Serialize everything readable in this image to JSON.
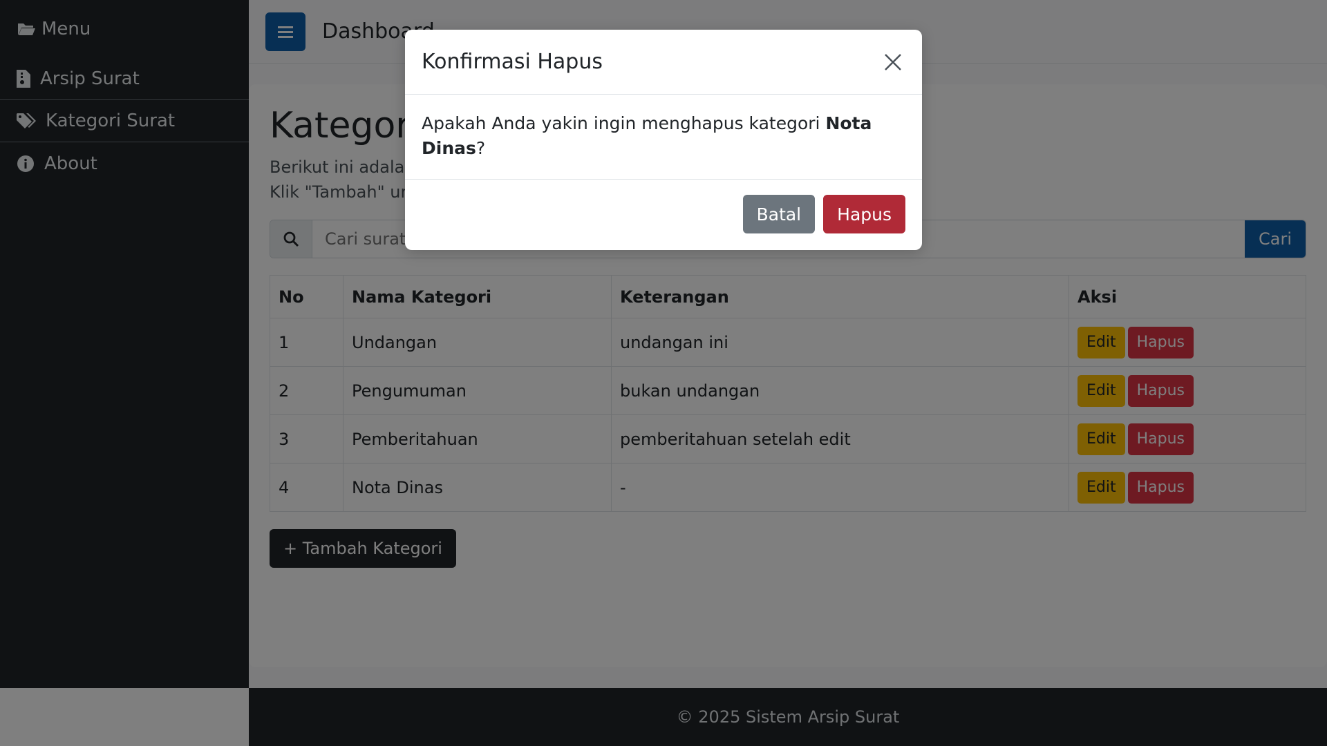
{
  "sidebar": {
    "title": "Menu",
    "items": [
      {
        "label": "Arsip Surat"
      },
      {
        "label": "Kategori Surat"
      },
      {
        "label": "About"
      }
    ]
  },
  "topbar": {
    "title": "Dashboard"
  },
  "page": {
    "title": "Kategori Surat",
    "desc_line1": "Berikut ini adalah kategori yang bisa digunakan untuk melabeli surat.",
    "desc_line2": "Klik \"Tambah\" untuk menambahkan kategori baru."
  },
  "search": {
    "placeholder": "Cari surat...",
    "button": "Cari"
  },
  "table": {
    "headers": [
      "No",
      "Nama Kategori",
      "Keterangan",
      "Aksi"
    ],
    "rows": [
      {
        "no": "1",
        "nama": "Undangan",
        "keterangan": "undangan ini"
      },
      {
        "no": "2",
        "nama": "Pengumuman",
        "keterangan": "bukan undangan"
      },
      {
        "no": "3",
        "nama": "Pemberitahuan",
        "keterangan": "pemberitahuan setelah edit"
      },
      {
        "no": "4",
        "nama": "Nota Dinas",
        "keterangan": "-"
      }
    ],
    "edit_label": "Edit",
    "delete_label": "Hapus"
  },
  "add_button": "+ Tambah Kategori",
  "footer": {
    "text": "© 2025 Sistem Arsip Surat"
  },
  "modal": {
    "title": "Konfirmasi Hapus",
    "body_prefix": "Apakah Anda yakin ingin menghapus kategori ",
    "body_name": "Nota Dinas",
    "body_suffix": "?",
    "cancel_label": "Batal",
    "confirm_label": "Hapus"
  },
  "colors": {
    "sidebar_bg": "#212529",
    "primary": "#0f5ea8",
    "warning": "#ffc107",
    "danger": "#dc3545",
    "secondary": "#6c757d"
  }
}
